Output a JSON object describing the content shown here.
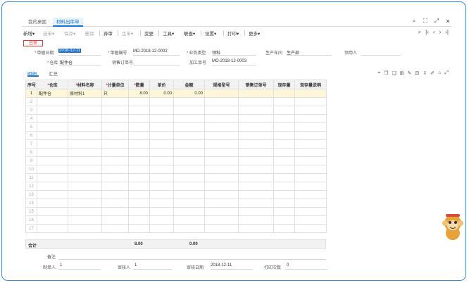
{
  "tabs": [
    {
      "label": "我的桌面",
      "active": false
    },
    {
      "label": "材料出库单",
      "active": true
    }
  ],
  "toolbar": {
    "new": "新增",
    "select": "选单",
    "save": "保存",
    "delete": "删除",
    "abandon": "弃审",
    "generate": "生单",
    "change": "变更",
    "tools": "工具",
    "link": "联查",
    "settings": "设置",
    "print": "打印",
    "more": "更多"
  },
  "status_badge": "已审",
  "form": {
    "doc_date_label": "单据日期",
    "doc_date_value": "2018-12-11",
    "doc_no_label": "单据编号",
    "doc_no_value": "MD-2018-12-0002",
    "biz_type_label": "业务类型",
    "biz_type_value": "领料",
    "workshop_label": "生产车间",
    "workshop_value": "生产部",
    "requester_label": "领用人",
    "requester_value": "",
    "warehouse_label": "仓库",
    "warehouse_value": "配件仓",
    "sales_order_label": "销售订单号",
    "sales_order_value": "",
    "process_order_label": "加工单号",
    "process_order_value": "MO-2018-12-0003"
  },
  "subtabs": [
    {
      "label": "明细",
      "active": true
    },
    {
      "label": "汇总",
      "active": false
    }
  ],
  "table": {
    "columns": [
      {
        "label": "序号",
        "required": false
      },
      {
        "label": "仓库",
        "required": true
      },
      {
        "label": "材料名称",
        "required": true
      },
      {
        "label": "计量单位",
        "required": true
      },
      {
        "label": "数量",
        "required": true
      },
      {
        "label": "单价",
        "required": false
      },
      {
        "label": "金额",
        "required": false
      },
      {
        "label": "规格型号",
        "required": false
      },
      {
        "label": "销售订单号",
        "required": false
      },
      {
        "label": "现存量",
        "required": false
      },
      {
        "label": "现存量说明",
        "required": false
      }
    ],
    "rows": [
      [
        "1",
        "配件仓",
        "原材料1",
        "只",
        "8.00",
        "0.00",
        "0.00",
        "",
        "",
        "",
        ""
      ],
      [
        "2",
        "",
        "",
        "",
        "",
        "",
        "",
        "",
        "",
        "",
        ""
      ],
      [
        "3",
        "",
        "",
        "",
        "",
        "",
        "",
        "",
        "",
        "",
        ""
      ],
      [
        "4",
        "",
        "",
        "",
        "",
        "",
        "",
        "",
        "",
        "",
        ""
      ],
      [
        "5",
        "",
        "",
        "",
        "",
        "",
        "",
        "",
        "",
        "",
        ""
      ],
      [
        "6",
        "",
        "",
        "",
        "",
        "",
        "",
        "",
        "",
        "",
        ""
      ],
      [
        "7",
        "",
        "",
        "",
        "",
        "",
        "",
        "",
        "",
        "",
        ""
      ],
      [
        "8",
        "",
        "",
        "",
        "",
        "",
        "",
        "",
        "",
        "",
        ""
      ],
      [
        "9",
        "",
        "",
        "",
        "",
        "",
        "",
        "",
        "",
        "",
        ""
      ],
      [
        "10",
        "",
        "",
        "",
        "",
        "",
        "",
        "",
        "",
        "",
        ""
      ],
      [
        "11",
        "",
        "",
        "",
        "",
        "",
        "",
        "",
        "",
        "",
        ""
      ],
      [
        "12",
        "",
        "",
        "",
        "",
        "",
        "",
        "",
        "",
        "",
        ""
      ],
      [
        "13",
        "",
        "",
        "",
        "",
        "",
        "",
        "",
        "",
        "",
        ""
      ],
      [
        "14",
        "",
        "",
        "",
        "",
        "",
        "",
        "",
        "",
        "",
        ""
      ],
      [
        "15",
        "",
        "",
        "",
        "",
        "",
        "",
        "",
        "",
        "",
        ""
      ],
      [
        "16",
        "",
        "",
        "",
        "",
        "",
        "",
        "",
        "",
        "",
        ""
      ],
      [
        "17",
        "",
        "",
        "",
        "",
        "",
        "",
        "",
        "",
        "",
        ""
      ]
    ]
  },
  "totals": {
    "label": "合计",
    "quantity": "8.00",
    "amount": "0.00"
  },
  "footer": {
    "remark_label": "备注",
    "creator_label": "制单人",
    "creator_value": "1",
    "reviewer_label": "审核人",
    "reviewer_value": "1",
    "review_date_label": "审核日期",
    "review_date_value": "2018-12-11",
    "print_count_label": "打印次数",
    "print_count_value": "0"
  }
}
